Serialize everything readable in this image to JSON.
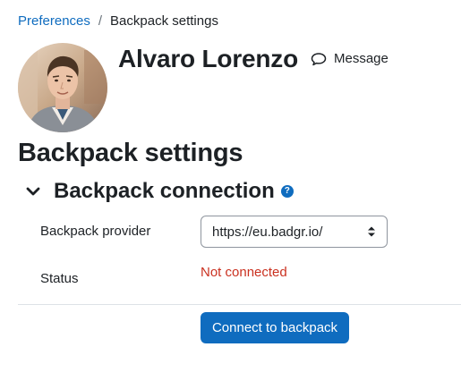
{
  "breadcrumb": {
    "items": [
      {
        "label": "Preferences",
        "link": true
      },
      {
        "label": "Backpack settings",
        "link": false
      }
    ],
    "separator": "/"
  },
  "user": {
    "name": "Alvaro Lorenzo",
    "avatar_icon": "user-avatar-photo"
  },
  "header_actions": {
    "message_label": "Message",
    "message_icon": "speech-bubble-icon"
  },
  "page": {
    "heading": "Backpack settings"
  },
  "section": {
    "title": "Backpack connection",
    "toggle_icon": "chevron-down-icon",
    "help_icon": "question-circle-icon",
    "help_glyph": "?"
  },
  "form": {
    "provider_label": "Backpack provider",
    "provider_value": "https://eu.badgr.io/",
    "status_label": "Status",
    "status_value": "Not connected"
  },
  "actions": {
    "connect_label": "Connect to backpack"
  },
  "colors": {
    "link": "#0f6cbf",
    "primary_button": "#0f6cbf",
    "status_error": "#ca3120",
    "text": "#1d2125"
  }
}
